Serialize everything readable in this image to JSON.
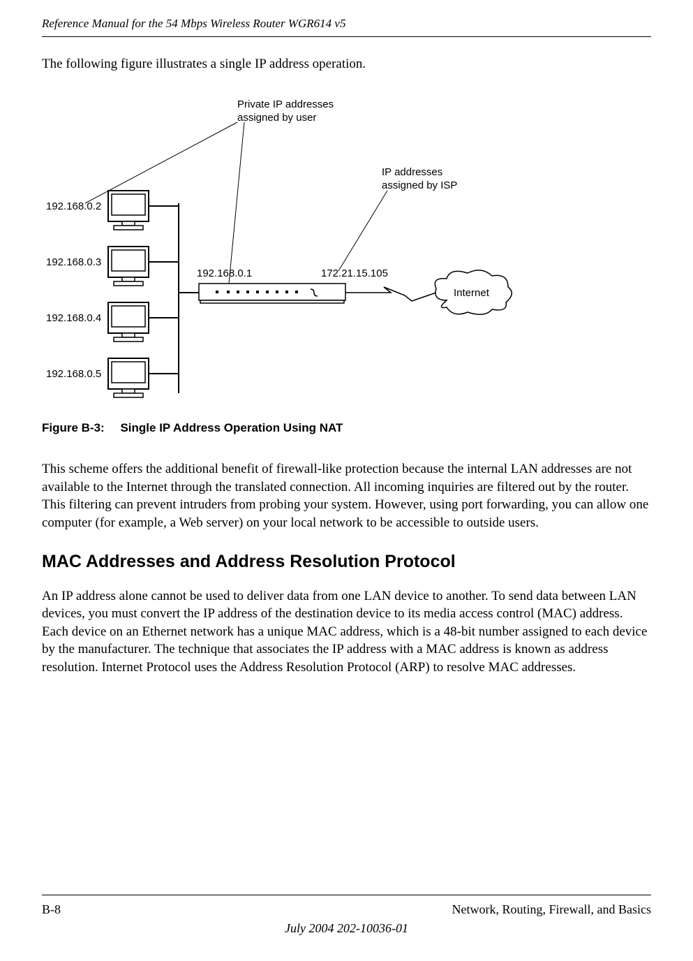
{
  "header": {
    "title": "Reference Manual for the 54 Mbps Wireless Router WGR614 v5"
  },
  "intro": "The following figure illustrates a single IP address operation.",
  "diagram": {
    "private_label_line1": "Private IP addresses",
    "private_label_line2": "assigned by user",
    "isp_label_line1": "IP addresses",
    "isp_label_line2": "assigned by ISP",
    "ip1": "192.168.0.2",
    "ip2": "192.168.0.3",
    "ip3": "192.168.0.4",
    "ip4": "192.168.0.5",
    "router_lan_ip": "192.168.0.1",
    "router_wan_ip": "172.21.15.105",
    "internet_label": "Internet"
  },
  "figure_caption_num": "Figure B-3:",
  "figure_caption_text": "Single IP Address Operation Using NAT",
  "paragraph1": "This scheme offers the additional benefit of firewall-like protection because the internal LAN addresses are not available to the Internet through the translated connection. All incoming inquiries are filtered out by the router. This filtering can prevent intruders from probing your system. However, using port forwarding, you can allow one computer (for example, a Web server) on your local network to be accessible to outside users.",
  "section_heading": "MAC Addresses and Address Resolution Protocol",
  "paragraph2": "An IP address alone cannot be used to deliver data from one LAN device to another. To send data between LAN devices, you must convert the IP address of the destination device to its media access control (MAC) address. Each device on an Ethernet network has a unique MAC address, which is a 48-bit number assigned to each device by the manufacturer. The technique that associates the IP address with a MAC address is known as address resolution. Internet Protocol uses the Address Resolution Protocol (ARP) to resolve MAC addresses.",
  "footer": {
    "page": "B-8",
    "section": "Network, Routing, Firewall, and Basics",
    "date": "July 2004 202-10036-01"
  }
}
